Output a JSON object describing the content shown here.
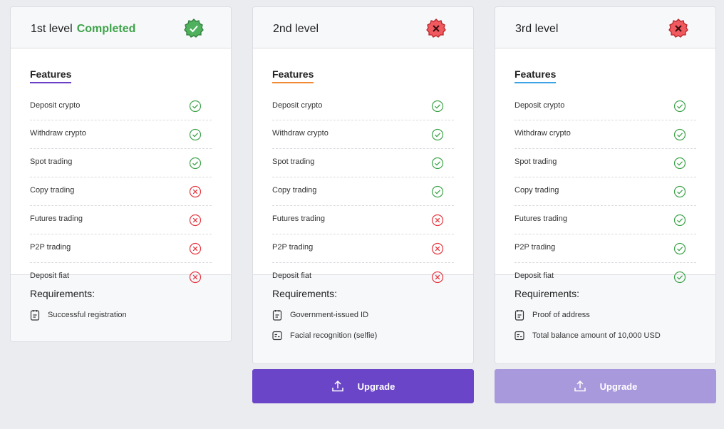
{
  "levels": [
    {
      "title": "1st level",
      "status": "Completed",
      "features_title": "Features",
      "features": [
        {
          "label": "Deposit crypto",
          "available": true
        },
        {
          "label": "Withdraw crypto",
          "available": true
        },
        {
          "label": "Spot trading",
          "available": true
        },
        {
          "label": "Copy trading",
          "available": false
        },
        {
          "label": "Futures trading",
          "available": false
        },
        {
          "label": "P2P trading",
          "available": false
        },
        {
          "label": "Deposit fiat",
          "available": false
        }
      ],
      "requirements_title": "Requirements:",
      "requirements": [
        "Successful registration"
      ]
    },
    {
      "title": "2nd level",
      "features_title": "Features",
      "features": [
        {
          "label": "Deposit crypto",
          "available": true
        },
        {
          "label": "Withdraw crypto",
          "available": true
        },
        {
          "label": "Spot trading",
          "available": true
        },
        {
          "label": "Copy trading",
          "available": true
        },
        {
          "label": "Futures trading",
          "available": false
        },
        {
          "label": "P2P trading",
          "available": false
        },
        {
          "label": "Deposit fiat",
          "available": false
        }
      ],
      "requirements_title": "Requirements:",
      "requirements": [
        "Government-issued ID",
        "Facial recognition (selfie)"
      ],
      "button_label": "Upgrade"
    },
    {
      "title": "3rd level",
      "features_title": "Features",
      "features": [
        {
          "label": "Deposit crypto",
          "available": true
        },
        {
          "label": "Withdraw crypto",
          "available": true
        },
        {
          "label": "Spot trading",
          "available": true
        },
        {
          "label": "Copy trading",
          "available": true
        },
        {
          "label": "Futures trading",
          "available": true
        },
        {
          "label": "P2P trading",
          "available": true
        },
        {
          "label": "Deposit fiat",
          "available": true
        }
      ],
      "requirements_title": "Requirements:",
      "requirements": [
        "Proof of address",
        "Total balance amount of 10,000 USD"
      ],
      "button_label": "Upgrade"
    }
  ],
  "colors": {
    "accent": "#6a45c8",
    "accent_disabled": "#a898dc",
    "success": "#3ea34a",
    "error": "#e5343d"
  }
}
